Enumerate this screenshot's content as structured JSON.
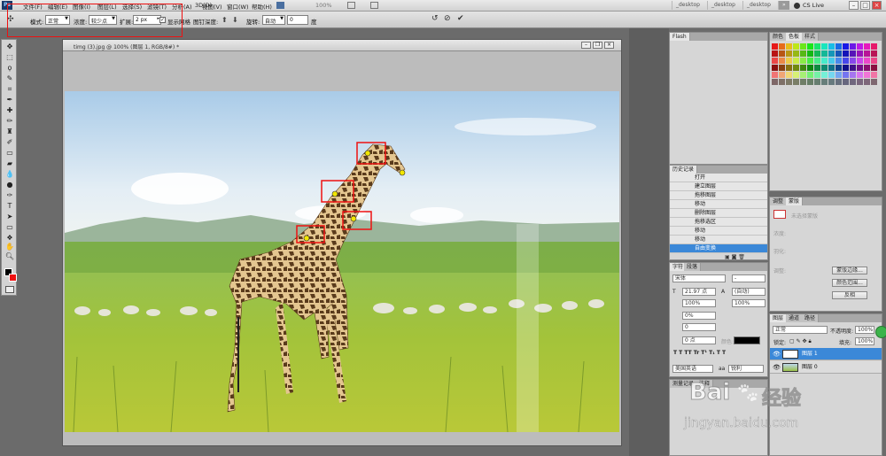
{
  "menu": {
    "items": [
      "文件(F)",
      "编辑(E)",
      "图像(I)",
      "图层(L)",
      "选择(S)",
      "滤镜(T)",
      "分析(A)",
      "3D(D)",
      "视图(V)",
      "窗口(W)",
      "帮助(H)"
    ],
    "zoom": "100%",
    "workspaces": [
      "_desktop",
      "_desktop",
      "_desktop"
    ],
    "cs_live": "CS Live",
    "more": "»"
  },
  "options": {
    "mode_label": "模式:",
    "mode_value": "正常",
    "density_label": "浓度:",
    "density_value": "较少点",
    "expand_label": "扩展:",
    "expand_value": "2 px",
    "show_mesh_label": "显示网格",
    "pin_depth_label": "图钉深度:",
    "rotate_label": "旋转:",
    "rotate_value": "自动",
    "angle_value": "0",
    "angle_unit": "度"
  },
  "document": {
    "title": "timg (3).jpg @ 100% (图层 1, RGB/8#) *"
  },
  "panels": {
    "flash_tab": "Flash",
    "swatch_tabs": [
      "颜色",
      "色板",
      "样式"
    ],
    "history_tab": "历史记录",
    "history_items": [
      "打开",
      "建立图层",
      "拖移图层",
      "移动",
      "删除图层",
      "拖移选区",
      "移动",
      "移动",
      "自由变换"
    ],
    "adjust_tabs": [
      "调整",
      "蒙版"
    ],
    "mask_text": "未选择蒙版",
    "density_label": "浓度:",
    "feather_label": "羽化:",
    "refine_label": "调整:",
    "mask_edge_button": "蒙版边缘...",
    "color_range_button": "颜色范围...",
    "invert_button": "反相",
    "char_tabs": [
      "字符",
      "段落"
    ],
    "font_family": "宋体",
    "font_style": "-",
    "font_size": "21.97 点",
    "leading": "(自动)",
    "tracking_a": "100%",
    "tracking_b": "100%",
    "scale": "0%",
    "kern": "0",
    "baseline": "0 点",
    "color_label": "颜色:",
    "language": "美国英语",
    "aa_label": "锐利",
    "para_tabs": [
      "测量记录",
      "注释"
    ],
    "layer_tabs": [
      "图层",
      "通道",
      "路径"
    ],
    "blend_mode": "正常",
    "opacity_label": "不透明度:",
    "opacity_value": "100%",
    "lock_label": "锁定:",
    "fill_label": "填充:",
    "fill_value": "100%",
    "layers": [
      "图层 1",
      "图层 0"
    ]
  },
  "watermark": {
    "brand": "Bai",
    "brand_tail": "经验",
    "url": "jingyan.baidu.com"
  },
  "colors": {
    "highlight": "#3b88d8",
    "annotation_red": "#ee1111",
    "mesh_pin": "#f2e600"
  }
}
